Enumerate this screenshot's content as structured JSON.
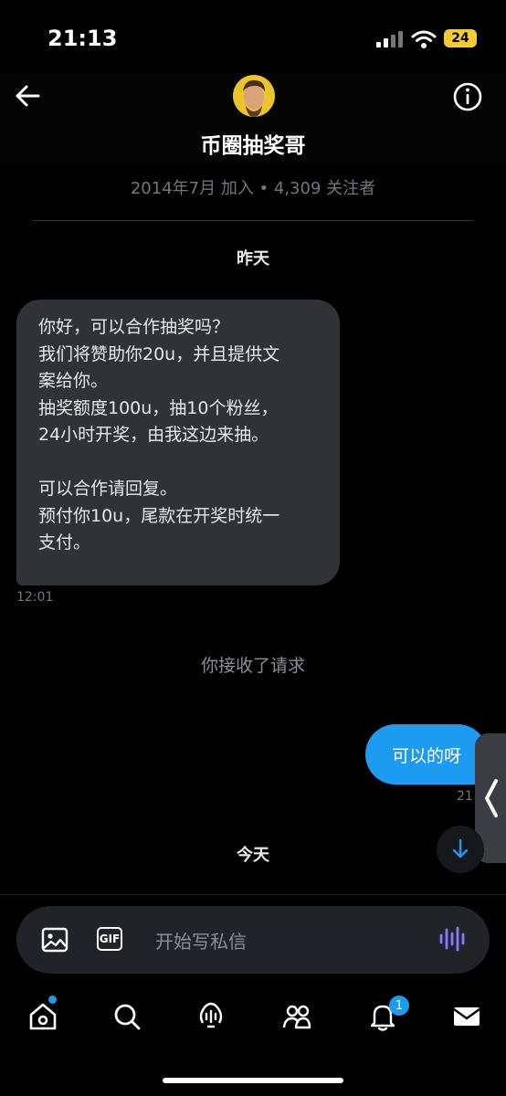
{
  "status_bar": {
    "time": "21:13",
    "battery": "24"
  },
  "header": {
    "back_icon": "arrow-left-icon",
    "info_icon": "info-icon",
    "name": "币圈抽奖哥",
    "meta": "2014年7月 加入 • 4,309 关注者"
  },
  "conversation": {
    "day_yesterday": "昨天",
    "incoming_message": {
      "text": "你好，可以合作抽奖吗？\n我们将赞助你20u，并且提供文\n案给你。\n抽奖额度100u，抽10个粉丝，\n24小时开奖，由我这边来抽。\n\n可以合作请回复。\n预付你10u，尾款在开奖时统一\n支付。",
      "timestamp": "12:01"
    },
    "system_notice": "你接收了请求",
    "outgoing_message": {
      "text": "可以的呀",
      "timestamp": "21"
    },
    "day_today": "今天"
  },
  "composer": {
    "placeholder": "开始写私信",
    "gif_label": "GIF",
    "image_icon": "image-icon",
    "voice_icon": "voice-wave-icon"
  },
  "tabbar": {
    "items": [
      "home-icon",
      "search-icon",
      "spaces-icon",
      "communities-icon",
      "notifications-icon",
      "messages-icon"
    ],
    "notification_badge": "1"
  },
  "colors": {
    "accent": "#1d9bf0",
    "incoming_bubble": "#2f3336",
    "background": "#000000",
    "voice": "#8f76ff"
  }
}
